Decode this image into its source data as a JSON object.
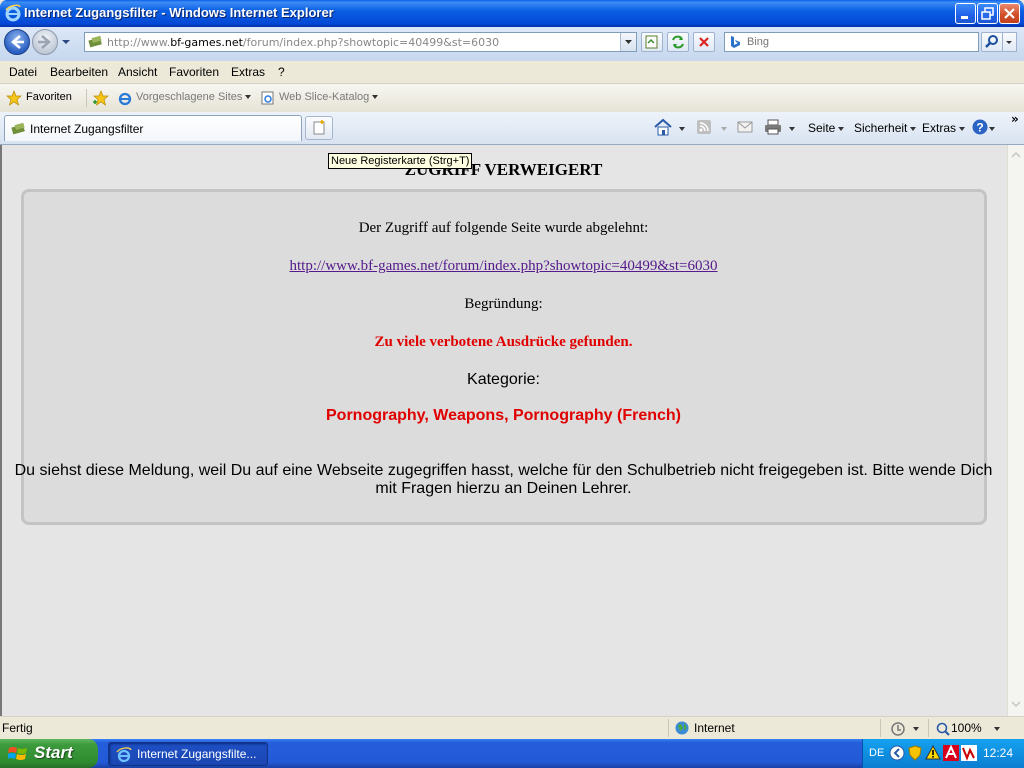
{
  "window": {
    "title": "Internet Zugangsfilter - Windows Internet Explorer"
  },
  "address": {
    "url_prefix": "http://www.",
    "url_domain": "bf-games.net",
    "url_path": "/forum/index.php?showtopic=40499&st=6030"
  },
  "search": {
    "placeholder": "Bing"
  },
  "menu": [
    "Datei",
    "Bearbeiten",
    "Ansicht",
    "Favoriten",
    "Extras",
    "?"
  ],
  "favorites": {
    "label": "Favoriten",
    "items": [
      "Vorgeschlagene Sites",
      "Web Slice-Katalog"
    ]
  },
  "tab": {
    "label": "Internet Zugangsfilter"
  },
  "tooltip": "Neue Registerkarte (Strg+T)",
  "commands": {
    "page": "Seite",
    "security": "Sicherheit",
    "tools": "Extras"
  },
  "page": {
    "heading": "ZUGRIFF VERWEIGERT",
    "intro": "Der Zugriff auf folgende Seite wurde abgelehnt:",
    "blocked_url": "http://www.bf-games.net/forum/index.php?showtopic=40499&st=6030",
    "reason_label": "Begründung:",
    "reason": "Zu viele verbotene Ausdrücke gefunden.",
    "category_label": "Kategorie:",
    "categories": "Pornography, Weapons, Pornography (French)",
    "notice_line1": "Du siehst diese Meldung, weil Du auf eine Webseite zugegriffen hasst, welche für den Schulbetrieb nicht freigegeben ist. Bitte wende Dich",
    "notice_line2": "mit Fragen hierzu an Deinen Lehrer."
  },
  "status": {
    "text": "Fertig",
    "zone": "Internet",
    "zoom": "100%"
  },
  "taskbar": {
    "start": "Start",
    "task": "Internet Zugangsfilte...",
    "lang": "DE",
    "clock": "12:24"
  },
  "colors": {
    "accent": "#e00000",
    "link": "#551a8b",
    "content_bg": "#e5e5e5",
    "panel_bg": "#dcdcdc"
  }
}
